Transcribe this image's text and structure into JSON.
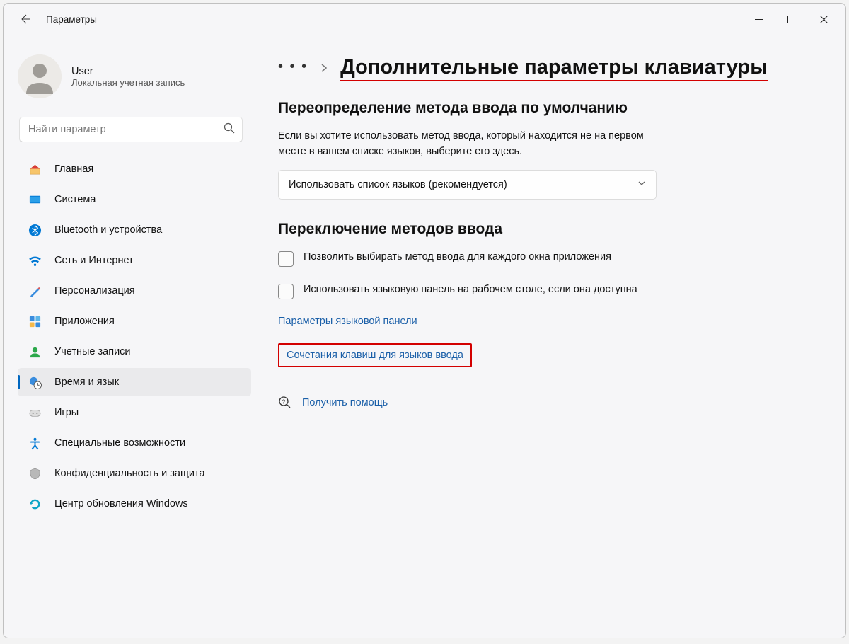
{
  "window": {
    "title": "Параметры"
  },
  "user": {
    "name": "User",
    "account_type": "Локальная учетная запись"
  },
  "search": {
    "placeholder": "Найти параметр"
  },
  "nav": {
    "home": "Главная",
    "system": "Система",
    "bluetooth": "Bluetooth и устройства",
    "network": "Сеть и Интернет",
    "personalization": "Персонализация",
    "apps": "Приложения",
    "accounts": "Учетные записи",
    "time_lang": "Время и язык",
    "gaming": "Игры",
    "accessibility": "Специальные возможности",
    "privacy": "Конфиденциальность и защита",
    "update": "Центр обновления Windows"
  },
  "breadcrumb": {
    "title": "Дополнительные параметры клавиатуры"
  },
  "section1": {
    "heading": "Переопределение метода ввода по умолчанию",
    "desc": "Если вы хотите использовать метод ввода, который находится не на первом месте в вашем списке языков, выберите его здесь.",
    "dropdown_value": "Использовать список языков (рекомендуется)"
  },
  "section2": {
    "heading": "Переключение методов ввода",
    "check1": "Позволить выбирать метод ввода для каждого окна приложения",
    "check2": "Использовать языковую панель на рабочем столе, если она доступна",
    "link_langbar": "Параметры языковой панели",
    "link_hotkeys": "Сочетания клавиш для языков ввода"
  },
  "help": {
    "label": "Получить помощь"
  }
}
